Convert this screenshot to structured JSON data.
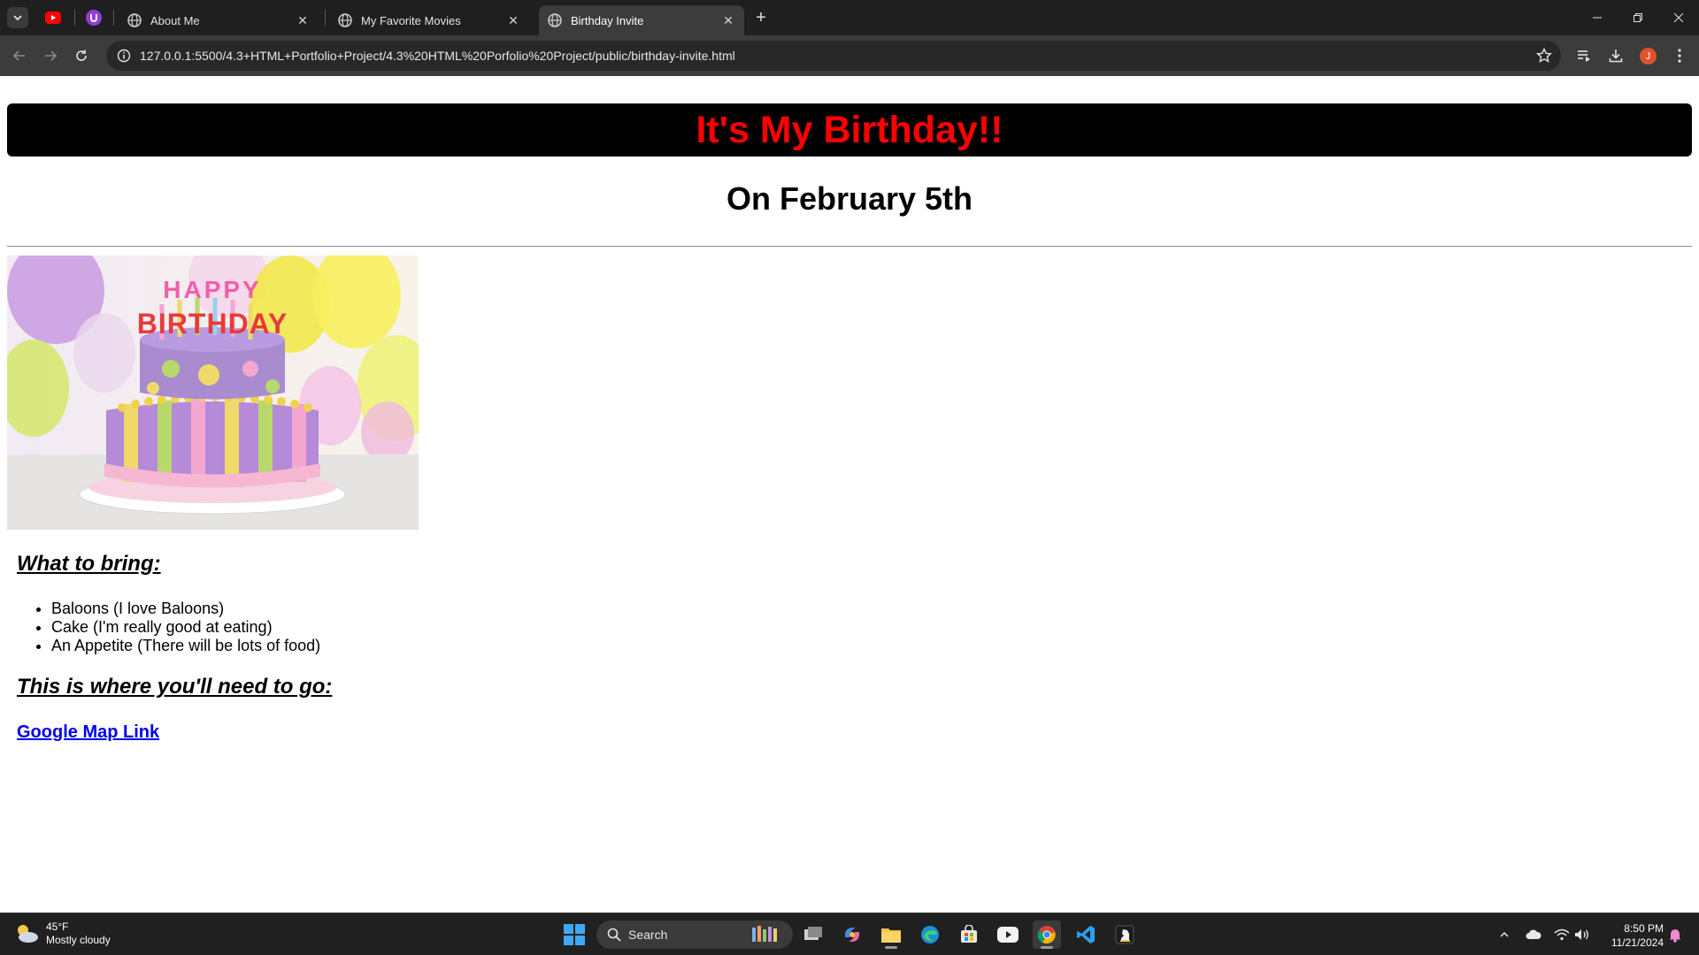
{
  "browser": {
    "tabs": [
      {
        "title": "About Me"
      },
      {
        "title": "My Favorite Movies"
      },
      {
        "title": "Birthday Invite"
      }
    ],
    "url": "127.0.0.1:5500/4.3+HTML+Portfolio+Project/4.3%20HTML%20Porfolio%20Project/public/birthday-invite.html",
    "profile_initial": "J"
  },
  "page": {
    "banner_title": "It's My Birthday!!",
    "subtitle": "On February 5th",
    "image": {
      "top_text": "HAPPY",
      "bottom_text": "BIRTHDAY"
    },
    "bring_heading": "What to bring:",
    "bring_items": [
      "Baloons (I love Baloons)",
      "Cake (I'm really good at eating)",
      "An Appetite (There will be lots of food)"
    ],
    "where_heading": "This is where you'll need to go:",
    "map_link": "Google Map Link"
  },
  "taskbar": {
    "weather_temp": "45°F",
    "weather_desc": "Mostly cloudy",
    "search_placeholder": "Search",
    "time": "8:50 PM",
    "date": "11/21/2024"
  },
  "colors": {
    "banner_bg": "#000000",
    "banner_text": "#ff0000",
    "link": "#0000ee"
  }
}
